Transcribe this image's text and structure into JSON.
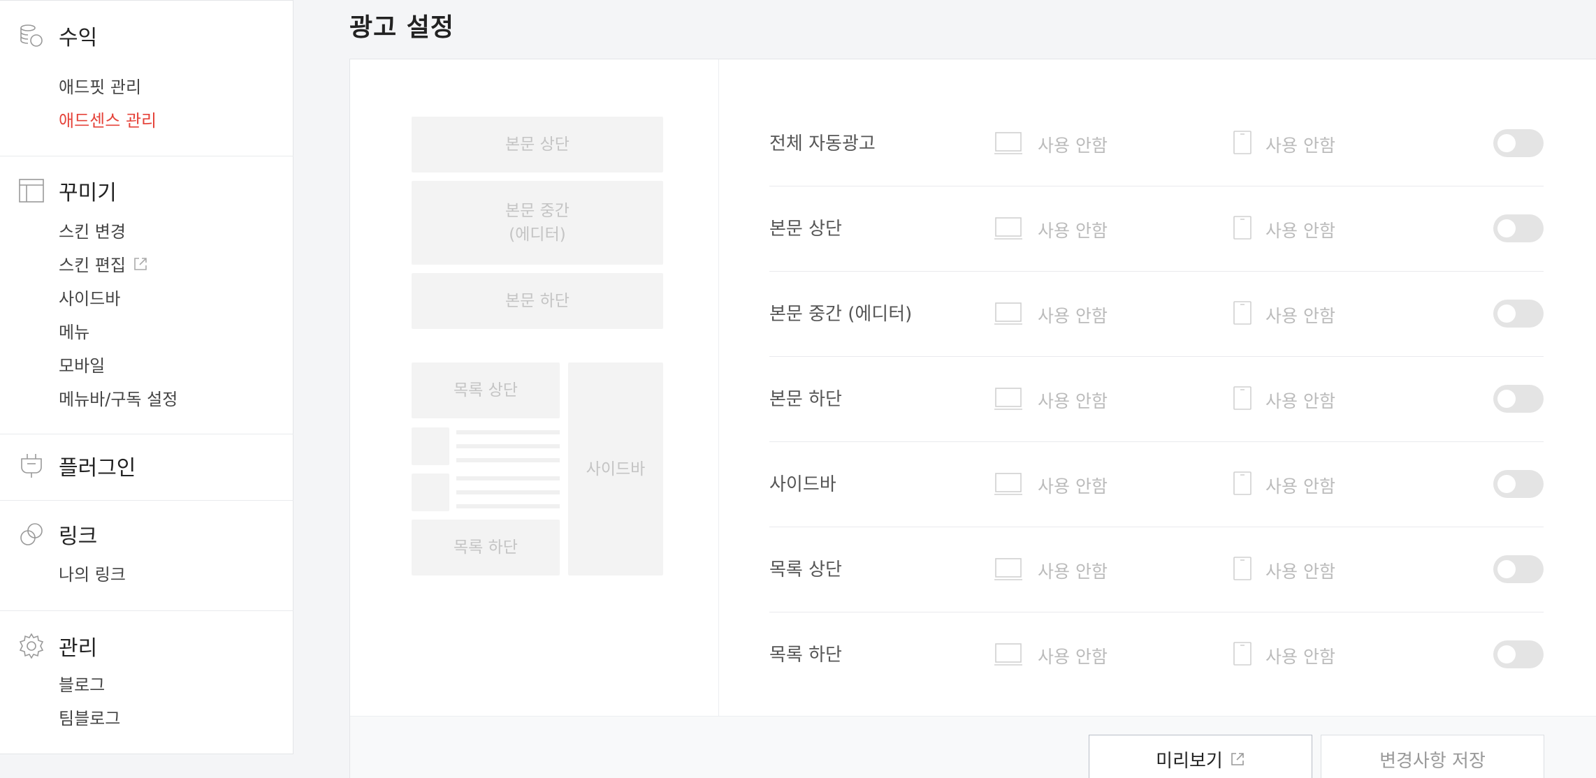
{
  "sidebar": {
    "revenue": {
      "title": "수익",
      "items": [
        "애드핏 관리",
        "애드센스 관리"
      ]
    },
    "decorate": {
      "title": "꾸미기",
      "items": [
        "스킨 변경",
        "스킨 편집",
        "사이드바",
        "메뉴",
        "모바일",
        "메뉴바/구독 설정"
      ]
    },
    "plugin": {
      "title": "플러그인"
    },
    "link": {
      "title": "링크",
      "items": [
        "나의 링크"
      ]
    },
    "manage": {
      "title": "관리",
      "items": [
        "블로그",
        "팀블로그"
      ]
    }
  },
  "page": {
    "title": "광고 설정"
  },
  "preview": {
    "body_top": "본문 상단",
    "body_middle_line1": "본문 중간",
    "body_middle_line2": "(에디터)",
    "body_bottom": "본문 하단",
    "list_top": "목록 상단",
    "list_bottom": "목록 하단",
    "sidebar": "사이드바"
  },
  "rows": [
    {
      "name": "전체 자동광고",
      "pc": "사용 안함",
      "mobile": "사용 안함",
      "enabled": false
    },
    {
      "name": "본문 상단",
      "pc": "사용 안함",
      "mobile": "사용 안함",
      "enabled": false
    },
    {
      "name": "본문 중간 (에디터)",
      "pc": "사용 안함",
      "mobile": "사용 안함",
      "enabled": false
    },
    {
      "name": "본문 하단",
      "pc": "사용 안함",
      "mobile": "사용 안함",
      "enabled": false
    },
    {
      "name": "사이드바",
      "pc": "사용 안함",
      "mobile": "사용 안함",
      "enabled": false
    },
    {
      "name": "목록 상단",
      "pc": "사용 안함",
      "mobile": "사용 안함",
      "enabled": false
    },
    {
      "name": "목록 하단",
      "pc": "사용 안함",
      "mobile": "사용 안함",
      "enabled": false
    }
  ],
  "footer": {
    "preview_label": "미리보기",
    "save_label": "변경사항 저장"
  },
  "colors": {
    "active": "#e5433a",
    "toggle_off": "#e4e4e4",
    "placeholder_bg": "#f3f3f3"
  }
}
